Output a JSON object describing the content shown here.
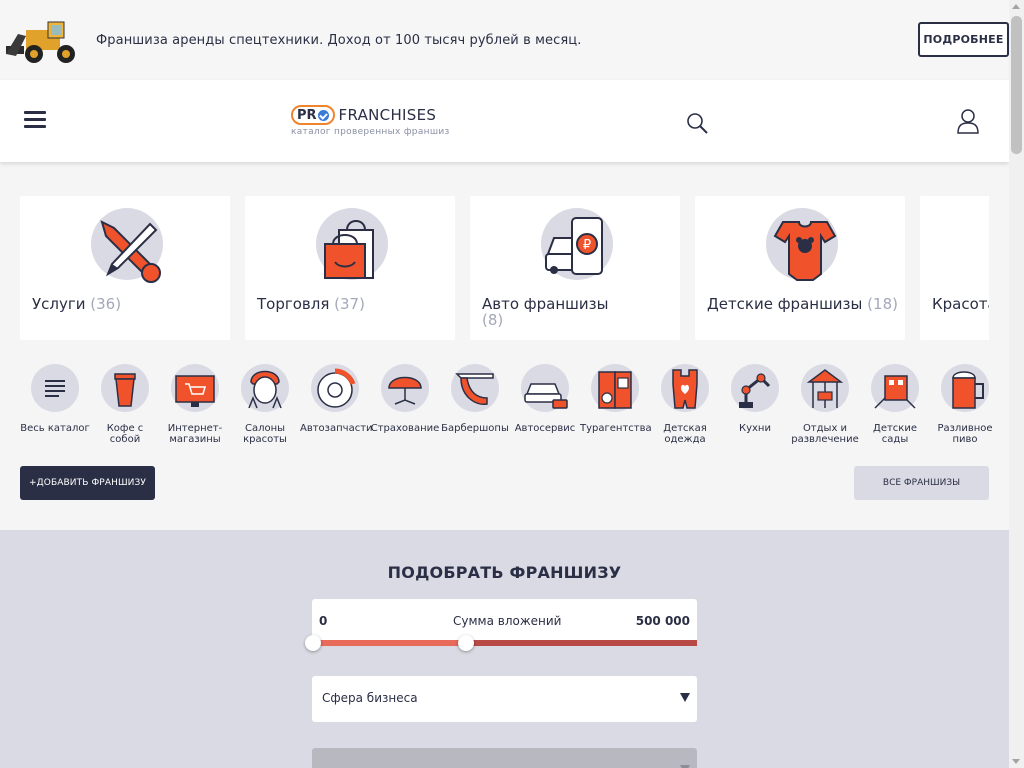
{
  "banner": {
    "text": "Франшиза аренды спецтехники. Доход от 100 тысяч рублей в месяц.",
    "button": "ПОДРОБНЕЕ"
  },
  "header": {
    "logo_pro": "PR",
    "logo_name": "FRANCHISES",
    "logo_sub": "каталог проверенных франшиз"
  },
  "categories": [
    {
      "title": "Услуги",
      "count": "(36)",
      "icon": "tools-icon"
    },
    {
      "title": "Торговля",
      "count": "(37)",
      "icon": "shopping-bag-icon"
    },
    {
      "title": "Авто франшизы",
      "count": "(8)",
      "icon": "car-ruble-icon"
    },
    {
      "title": "Детские франшизы",
      "count": "(18)",
      "icon": "baby-onesie-icon"
    },
    {
      "title": "Красота и здоровье",
      "count": "",
      "icon": "beauty-icon"
    }
  ],
  "icons": [
    {
      "label": "Весь каталог",
      "icon": "list-icon"
    },
    {
      "label": "Кофе с собой",
      "icon": "coffee-cup-icon"
    },
    {
      "label": "Интернет-магазины",
      "icon": "online-shop-icon"
    },
    {
      "label": "Салоны красоты",
      "icon": "beauty-salon-icon"
    },
    {
      "label": "Автозапчасти",
      "icon": "brake-disc-icon"
    },
    {
      "label": "Страхование",
      "icon": "umbrella-icon"
    },
    {
      "label": "Барбершопы",
      "icon": "razor-icon"
    },
    {
      "label": "Автосервис",
      "icon": "car-service-icon"
    },
    {
      "label": "Турагентства",
      "icon": "travel-icon"
    },
    {
      "label": "Детская одежда",
      "icon": "kids-clothes-icon"
    },
    {
      "label": "Кухни",
      "icon": "kitchen-robot-icon"
    },
    {
      "label": "Отдых и развлечение",
      "icon": "carousel-icon"
    },
    {
      "label": "Детские сады",
      "icon": "kindergarten-icon"
    },
    {
      "label": "Разливное пиво",
      "icon": "beer-icon"
    }
  ],
  "buttons": {
    "add": "+ДОБАВИТЬ ФРАНШИЗУ",
    "all": "ВСЕ ФРАНШИЗЫ"
  },
  "filter": {
    "title": "ПОДОБРАТЬ ФРАНШИЗУ",
    "range_min": "0",
    "range_label": "Сумма вложений",
    "range_max": "500 000",
    "range_fill_fraction": 0.4,
    "sphere_label": "Сфера бизнеса"
  },
  "colors": {
    "accent": "#f0532c",
    "dark": "#2b2f45",
    "bubble": "#d9dae3"
  }
}
